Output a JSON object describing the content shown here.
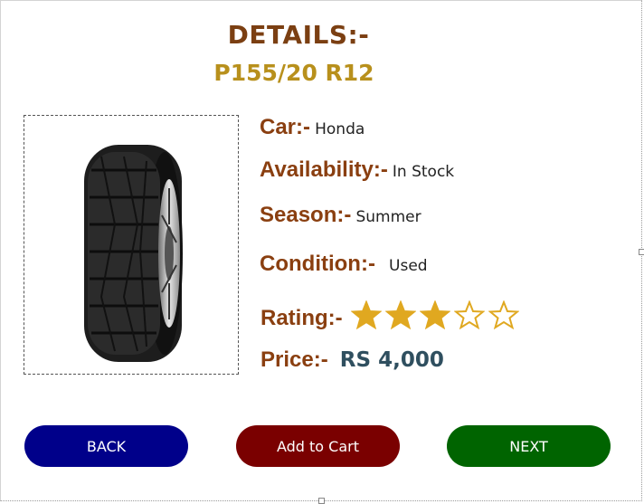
{
  "header": {
    "title": "DETAILS:-",
    "model": "P155/20 R12"
  },
  "product_image": {
    "icon": "tire-image"
  },
  "details": {
    "car_label": "Car:-",
    "car_value": "Honda",
    "availability_label": "Availability:-",
    "availability_value": "In Stock",
    "season_label": "Season:-",
    "season_value": "Summer",
    "condition_label": "Condition:-",
    "condition_value": "Used",
    "rating_label": "Rating:-",
    "rating_value": 3,
    "rating_max": 5,
    "price_label": "Price:-",
    "price_value": "RS 4,000"
  },
  "buttons": {
    "back": "BACK",
    "add_to_cart": "Add to Cart",
    "next": "NEXT"
  },
  "colors": {
    "label": "#8a3f10",
    "model": "#b8901c",
    "star": "#e0a820",
    "back_button": "#00008a",
    "cart_button": "#7a0000",
    "next_button": "#006400"
  }
}
